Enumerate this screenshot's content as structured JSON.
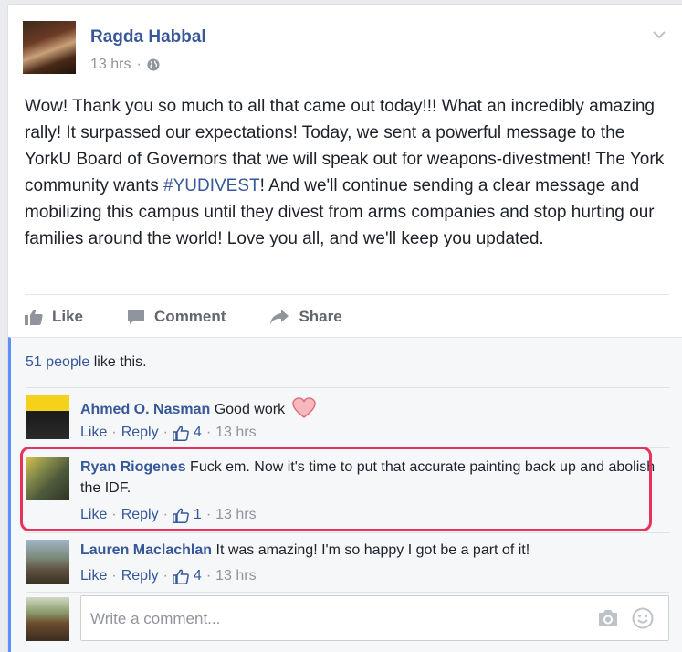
{
  "post": {
    "author": "Ragda Habbal",
    "time": "13 hrs",
    "dot": "·",
    "text_part1": "Wow! Thank you so much to all that came out today!!! What an incredibly amazing rally! It surpassed our expectations! Today, we sent a powerful message to the YorkU Board of Governors that we will speak out for weapons-divestment! The York community wants ",
    "hashtag": "#YUDIVEST",
    "text_part2": "! And we'll continue sending a clear message and mobilizing this campus until they divest from arms companies and stop hurting our families around the world! Love you all, and we'll keep you updated."
  },
  "actions": {
    "like": "Like",
    "comment": "Comment",
    "share": "Share"
  },
  "likes": {
    "count_text": "51 people",
    "suffix": " like this."
  },
  "comments": [
    {
      "name": "Ahmed O. Nasman",
      "text": " Good work",
      "like": "Like",
      "reply": "Reply",
      "likes": "4",
      "time": "13 hrs"
    },
    {
      "name": "Ryan Riogenes",
      "text": " Fuck em. Now it's time to put that accurate painting back up and abolish the IDF.",
      "like": "Like",
      "reply": "Reply",
      "likes": "1",
      "time": "13 hrs"
    },
    {
      "name": "Lauren Maclachlan",
      "text": " It was amazing! I'm so happy I got be a part of it!",
      "like": "Like",
      "reply": "Reply",
      "likes": "4",
      "time": "13 hrs"
    }
  ],
  "separator_dot": "·",
  "composer": {
    "placeholder": "Write a comment..."
  },
  "colors": {
    "link": "#365899",
    "highlight": "#e8345c",
    "accent_bar": "#5890ff"
  }
}
